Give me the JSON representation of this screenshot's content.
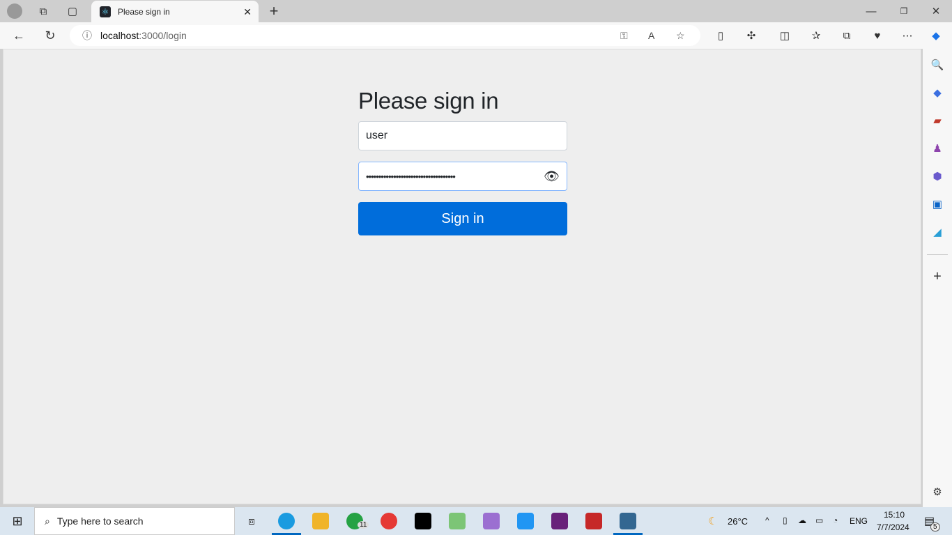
{
  "browser": {
    "tab_title": "Please sign in",
    "url_host": "localhost",
    "url_path": ":3000/login",
    "new_tab": "+"
  },
  "form": {
    "heading": "Please sign in",
    "username_value": "user",
    "password_masked": "••••••••••••••••••••••••••••••••••••",
    "submit_label": "Sign in"
  },
  "colors": {
    "primary": "#006ddb",
    "page_bg": "#eeeeee"
  },
  "taskbar": {
    "search_placeholder": "Type here to search",
    "weather": "26°C",
    "language": "ENG",
    "time": "15:10",
    "date": "7/7/2024",
    "whatsapp_badge": "11",
    "notifications": "5"
  }
}
